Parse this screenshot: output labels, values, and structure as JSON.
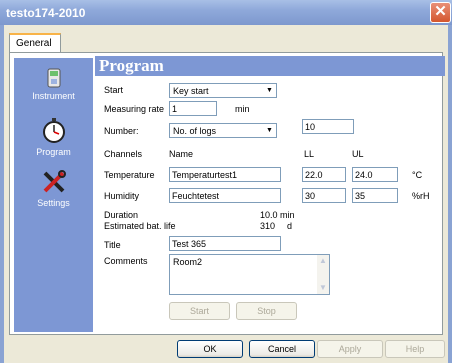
{
  "window": {
    "title": "testo174-2010",
    "close_glyph": "✕"
  },
  "tabs": [
    {
      "label": "General"
    }
  ],
  "sidebar": {
    "items": [
      {
        "label": "Instrument",
        "icon": "instrument-icon"
      },
      {
        "label": "Program",
        "icon": "stopwatch-icon"
      },
      {
        "label": "Settings",
        "icon": "tools-icon"
      }
    ]
  },
  "program": {
    "header": "Program",
    "start": {
      "label": "Start",
      "value": "Key start"
    },
    "measuring_rate": {
      "label": "Measuring rate",
      "value": "1",
      "unit": "min"
    },
    "number": {
      "label": "Number:",
      "value": "No. of logs",
      "count": "10"
    },
    "channels": {
      "label": "Channels",
      "col_name": "Name",
      "col_ll": "LL",
      "col_ul": "UL",
      "rows": [
        {
          "label": "Temperature",
          "name": "Temperaturtest1",
          "ll": "22.0",
          "ul": "24.0",
          "unit": "°C"
        },
        {
          "label": "Humidity",
          "name": "Feuchtetest",
          "ll": "30",
          "ul": "35",
          "unit": "%rH"
        }
      ]
    },
    "duration": {
      "label": "Duration",
      "value": "10.0 min"
    },
    "battery": {
      "label": "Estimated bat. life",
      "value": "310",
      "unit": "d"
    },
    "title": {
      "label": "Title",
      "value": "Test 365"
    },
    "comments": {
      "label": "Comments",
      "value": "Room2"
    },
    "start_button": "Start",
    "stop_button": "Stop"
  },
  "footer": {
    "ok": "OK",
    "cancel": "Cancel",
    "apply": "Apply",
    "help": "Help"
  },
  "colors": {
    "accent": "#7D97D4",
    "title_bar": "#8FA9DA",
    "close": "#D4562E",
    "face": "#ECE9D8"
  }
}
